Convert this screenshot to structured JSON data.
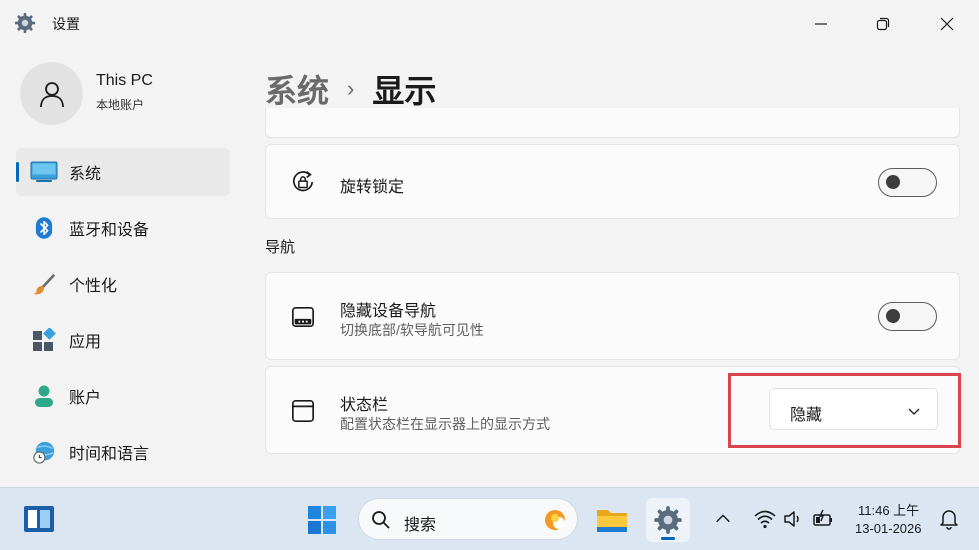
{
  "window": {
    "title": "设置",
    "controls": [
      "minimize",
      "maximize",
      "close"
    ]
  },
  "profile": {
    "name": "This PC",
    "account_type": "本地账户"
  },
  "sidebar": {
    "items": [
      {
        "label": "系统",
        "icon": "monitor-icon",
        "active": true
      },
      {
        "label": "蓝牙和设备",
        "icon": "bluetooth-icon",
        "active": false
      },
      {
        "label": "个性化",
        "icon": "brush-icon",
        "active": false
      },
      {
        "label": "应用",
        "icon": "apps-icon",
        "active": false
      },
      {
        "label": "账户",
        "icon": "person-icon",
        "active": false
      },
      {
        "label": "时间和语言",
        "icon": "globe-clock-icon",
        "active": false
      }
    ]
  },
  "breadcrumb": {
    "parent": "系统",
    "separator": "›",
    "current": "显示"
  },
  "settings": {
    "rotation_lock": {
      "title": "旋转锁定",
      "icon": "rotation-lock-icon",
      "toggle": "off"
    },
    "section_navigation": "导航",
    "hide_nav": {
      "title": "隐藏设备导航",
      "description": "切换底部/软导航可见性",
      "icon": "tablet-nav-icon",
      "toggle": "off"
    },
    "status_bar": {
      "title": "状态栏",
      "description": "配置状态栏在显示器上的显示方式",
      "icon": "window-icon",
      "dropdown_value": "隐藏"
    }
  },
  "taskbar": {
    "search_placeholder": "搜索",
    "apps": [
      "widgets-icon",
      "start-icon",
      "file-explorer-icon",
      "settings-icon"
    ],
    "tray": [
      "chevron-up-icon",
      "wifi-icon",
      "volume-icon",
      "battery-icon",
      "bell-icon"
    ],
    "time": "11:46 上午",
    "date": "13-01-2026"
  },
  "colors": {
    "accent": "#0067c0",
    "highlight_border": "#d9464e",
    "background": "#f3f3f3",
    "card": "#fbfbfb",
    "taskbar": "#dbe6f2"
  }
}
